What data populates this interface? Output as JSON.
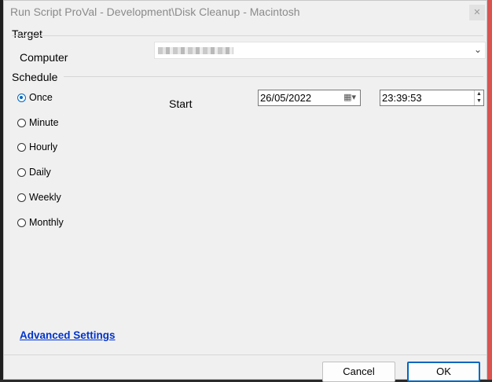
{
  "window": {
    "title": "Run Script ProVal - Development\\Disk Cleanup - Macintosh",
    "close_icon": "close-icon"
  },
  "target": {
    "section_label": "Target",
    "computer_label": "Computer",
    "computer_value_redacted": true
  },
  "schedule": {
    "section_label": "Schedule",
    "options": [
      {
        "label": "Once",
        "checked": true
      },
      {
        "label": "Minute",
        "checked": false
      },
      {
        "label": "Hourly",
        "checked": false
      },
      {
        "label": "Daily",
        "checked": false
      },
      {
        "label": "Weekly",
        "checked": false
      },
      {
        "label": "Monthly",
        "checked": false
      }
    ],
    "start_label": "Start",
    "start_date": "26/05/2022",
    "start_time": "23:39:53"
  },
  "links": {
    "advanced_settings": "Advanced Settings"
  },
  "buttons": {
    "cancel": "Cancel",
    "ok": "OK"
  },
  "colors": {
    "accent": "#0067c0",
    "link": "#0033cc"
  }
}
